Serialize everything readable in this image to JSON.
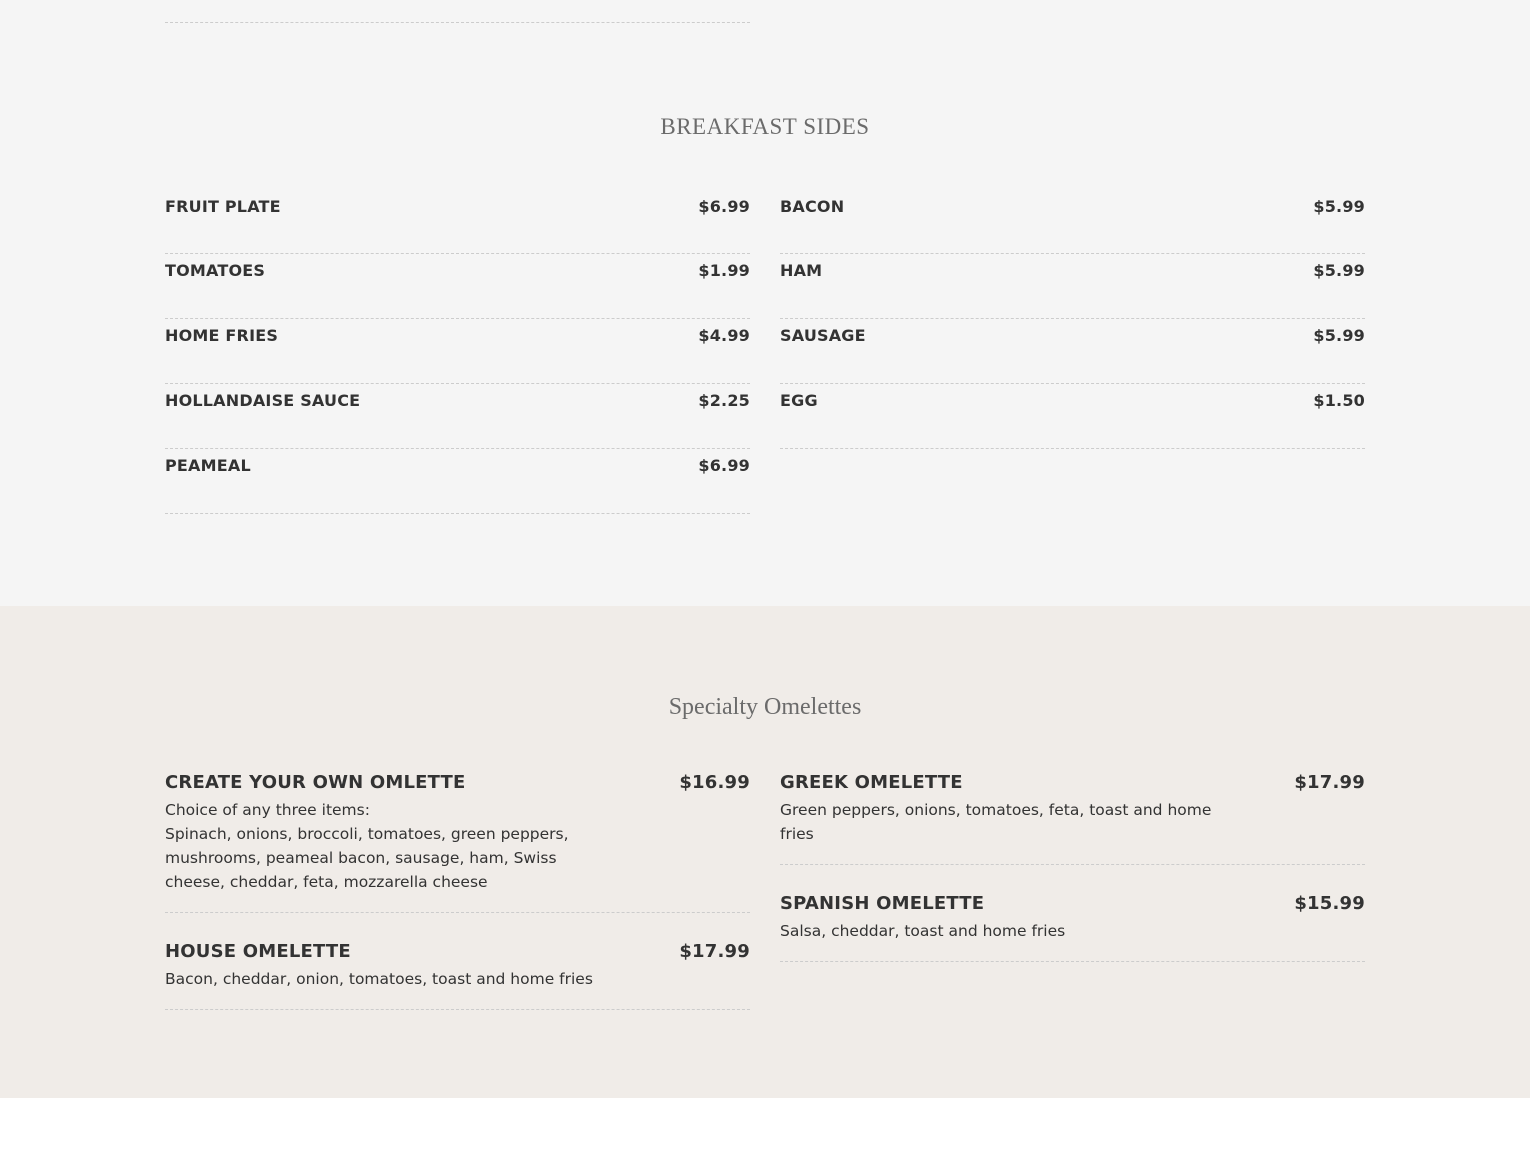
{
  "sides": {
    "title": "BREAKFAST SIDES",
    "left": [
      {
        "name": "FRUIT PLATE",
        "price": "$6.99"
      },
      {
        "name": "TOMATOES",
        "price": "$1.99"
      },
      {
        "name": "HOME FRIES",
        "price": "$4.99"
      },
      {
        "name": "HOLLANDAISE SAUCE",
        "price": "$2.25"
      },
      {
        "name": "PEAMEAL",
        "price": "$6.99"
      }
    ],
    "right": [
      {
        "name": "BACON",
        "price": "$5.99"
      },
      {
        "name": "HAM",
        "price": "$5.99"
      },
      {
        "name": "SAUSAGE",
        "price": "$5.99"
      },
      {
        "name": "EGG",
        "price": "$1.50"
      }
    ]
  },
  "omelettes": {
    "title": "Specialty Omelettes",
    "left": [
      {
        "name": "CREATE YOUR OWN OMLETTE",
        "price": "$16.99",
        "desc_line1": "Choice of any three items:",
        "desc_line2": "Spinach, onions, broccoli, tomatoes, green peppers, mushrooms, peameal bacon, sausage, ham, Swiss cheese, cheddar, feta, mozzarella cheese"
      },
      {
        "name": "HOUSE OMELETTE",
        "price": "$17.99",
        "desc_line1": "Bacon, cheddar, onion, tomatoes, toast and home fries"
      }
    ],
    "right": [
      {
        "name": "GREEK OMELETTE",
        "price": "$17.99",
        "desc_line1": "Green peppers, onions, tomatoes, feta, toast and home fries"
      },
      {
        "name": "SPANISH OMELETTE",
        "price": "$15.99",
        "desc_line1": "Salsa, cheddar, toast and home fries"
      }
    ]
  }
}
